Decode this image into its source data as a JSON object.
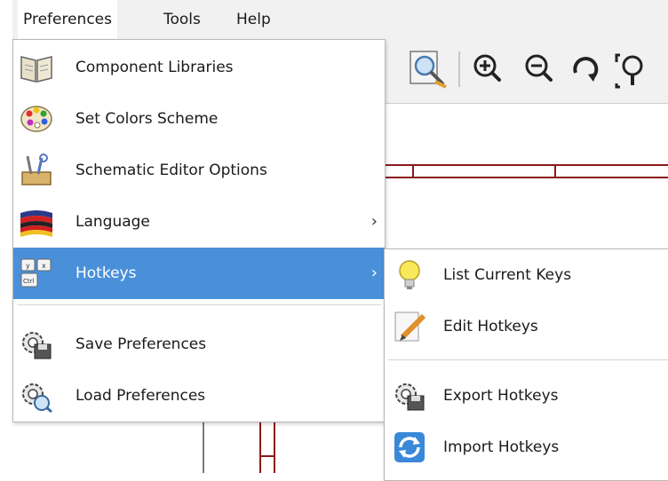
{
  "menubar": {
    "items": [
      "Preferences",
      "Tools",
      "Help"
    ]
  },
  "preferences_menu": {
    "items": [
      {
        "label": "Component Libraries",
        "icon": "book-icon"
      },
      {
        "label": "Set Colors Scheme",
        "icon": "palette-icon"
      },
      {
        "label": "Schematic Editor Options",
        "icon": "toolbox-icon"
      },
      {
        "label": "Language",
        "icon": "flag-icon",
        "submenu": true
      },
      {
        "label": "Hotkeys",
        "icon": "keyboard-keys-icon",
        "submenu": true,
        "highlighted": true
      },
      {
        "label": "Save Preferences",
        "icon": "gear-save-icon"
      },
      {
        "label": "Load Preferences",
        "icon": "gear-load-icon"
      }
    ]
  },
  "hotkeys_submenu": {
    "items": [
      {
        "label": "List Current Keys",
        "icon": "lightbulb-icon"
      },
      {
        "label": "Edit Hotkeys",
        "icon": "edit-pencil-icon"
      },
      {
        "label": "Export Hotkeys",
        "icon": "gear-export-icon"
      },
      {
        "label": "Import Hotkeys",
        "icon": "refresh-icon"
      }
    ]
  },
  "toolbar": {
    "buttons": [
      "zoom-page-icon",
      "zoom-in-icon",
      "zoom-out-icon",
      "redraw-icon",
      "zoom-fit-icon"
    ]
  },
  "colors": {
    "highlight": "#4a90d9",
    "wire": "#8b1a1a",
    "menubar": "#f1f1f1"
  }
}
